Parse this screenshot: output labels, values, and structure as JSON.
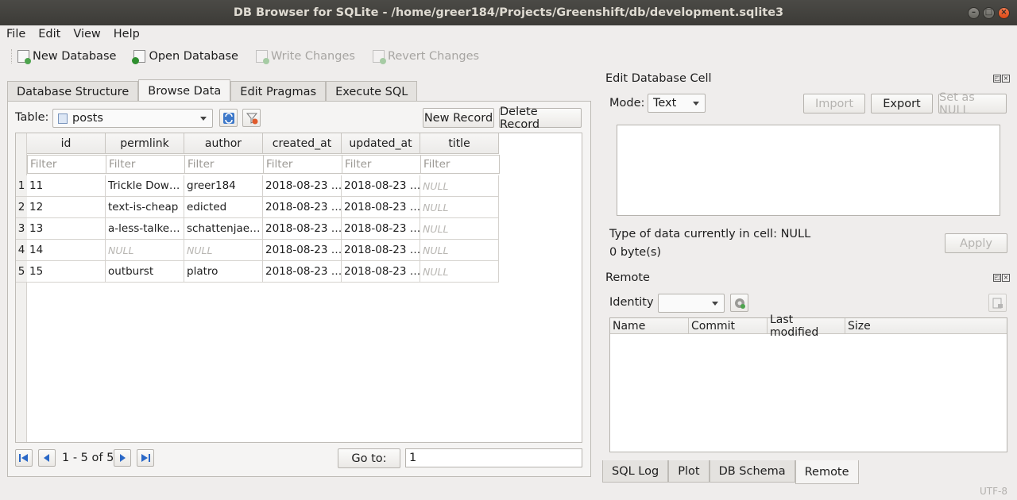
{
  "window": {
    "title": "DB Browser for SQLite - /home/greer184/Projects/Greenshift/db/development.sqlite3",
    "minimize_glyph": "–",
    "maximize_glyph": "□",
    "close_glyph": "×"
  },
  "menu": [
    "File",
    "Edit",
    "View",
    "Help"
  ],
  "toolbar": {
    "new_db": "New Database",
    "open_db": "Open Database",
    "write_changes": "Write Changes",
    "revert_changes": "Revert Changes"
  },
  "tabs": [
    "Database Structure",
    "Browse Data",
    "Edit Pragmas",
    "Execute SQL"
  ],
  "browse": {
    "table_label": "Table:",
    "table_selected": "posts",
    "new_record": "New Record",
    "delete_record": "Delete Record",
    "columns": [
      "id",
      "permlink",
      "author",
      "created_at",
      "updated_at",
      "title"
    ],
    "filter_placeholder": "Filter",
    "rows": [
      {
        "num": "1",
        "cells": [
          "11",
          "Trickle Dow…",
          "greer184",
          "2018-08-23 …",
          "2018-08-23 …",
          "NULL"
        ]
      },
      {
        "num": "2",
        "cells": [
          "12",
          "text-is-cheap",
          "edicted",
          "2018-08-23 …",
          "2018-08-23 …",
          "NULL"
        ]
      },
      {
        "num": "3",
        "cells": [
          "13",
          "a-less-talke…",
          "schattenjae…",
          "2018-08-23 …",
          "2018-08-23 …",
          "NULL"
        ]
      },
      {
        "num": "4",
        "cells": [
          "14",
          "NULL",
          "NULL",
          "2018-08-23 …",
          "2018-08-23 …",
          "NULL"
        ]
      },
      {
        "num": "5",
        "cells": [
          "15",
          "outburst",
          "platro",
          "2018-08-23 …",
          "2018-08-23 …",
          "NULL"
        ]
      }
    ],
    "pager_text": "1 - 5 of 5",
    "goto_label": "Go to:",
    "goto_value": "1"
  },
  "edit_cell": {
    "title": "Edit Database Cell",
    "mode_label": "Mode:",
    "mode_value": "Text",
    "import": "Import",
    "export": "Export",
    "set_null": "Set as NULL",
    "type_text": "Type of data currently in cell: NULL",
    "size_text": "0 byte(s)",
    "apply": "Apply"
  },
  "remote": {
    "title": "Remote",
    "identity_label": "Identity",
    "columns": [
      "Name",
      "Commit",
      "Last modified",
      "Size"
    ]
  },
  "bottom_tabs": [
    "SQL Log",
    "Plot",
    "DB Schema",
    "Remote"
  ],
  "status": "UTF-8"
}
